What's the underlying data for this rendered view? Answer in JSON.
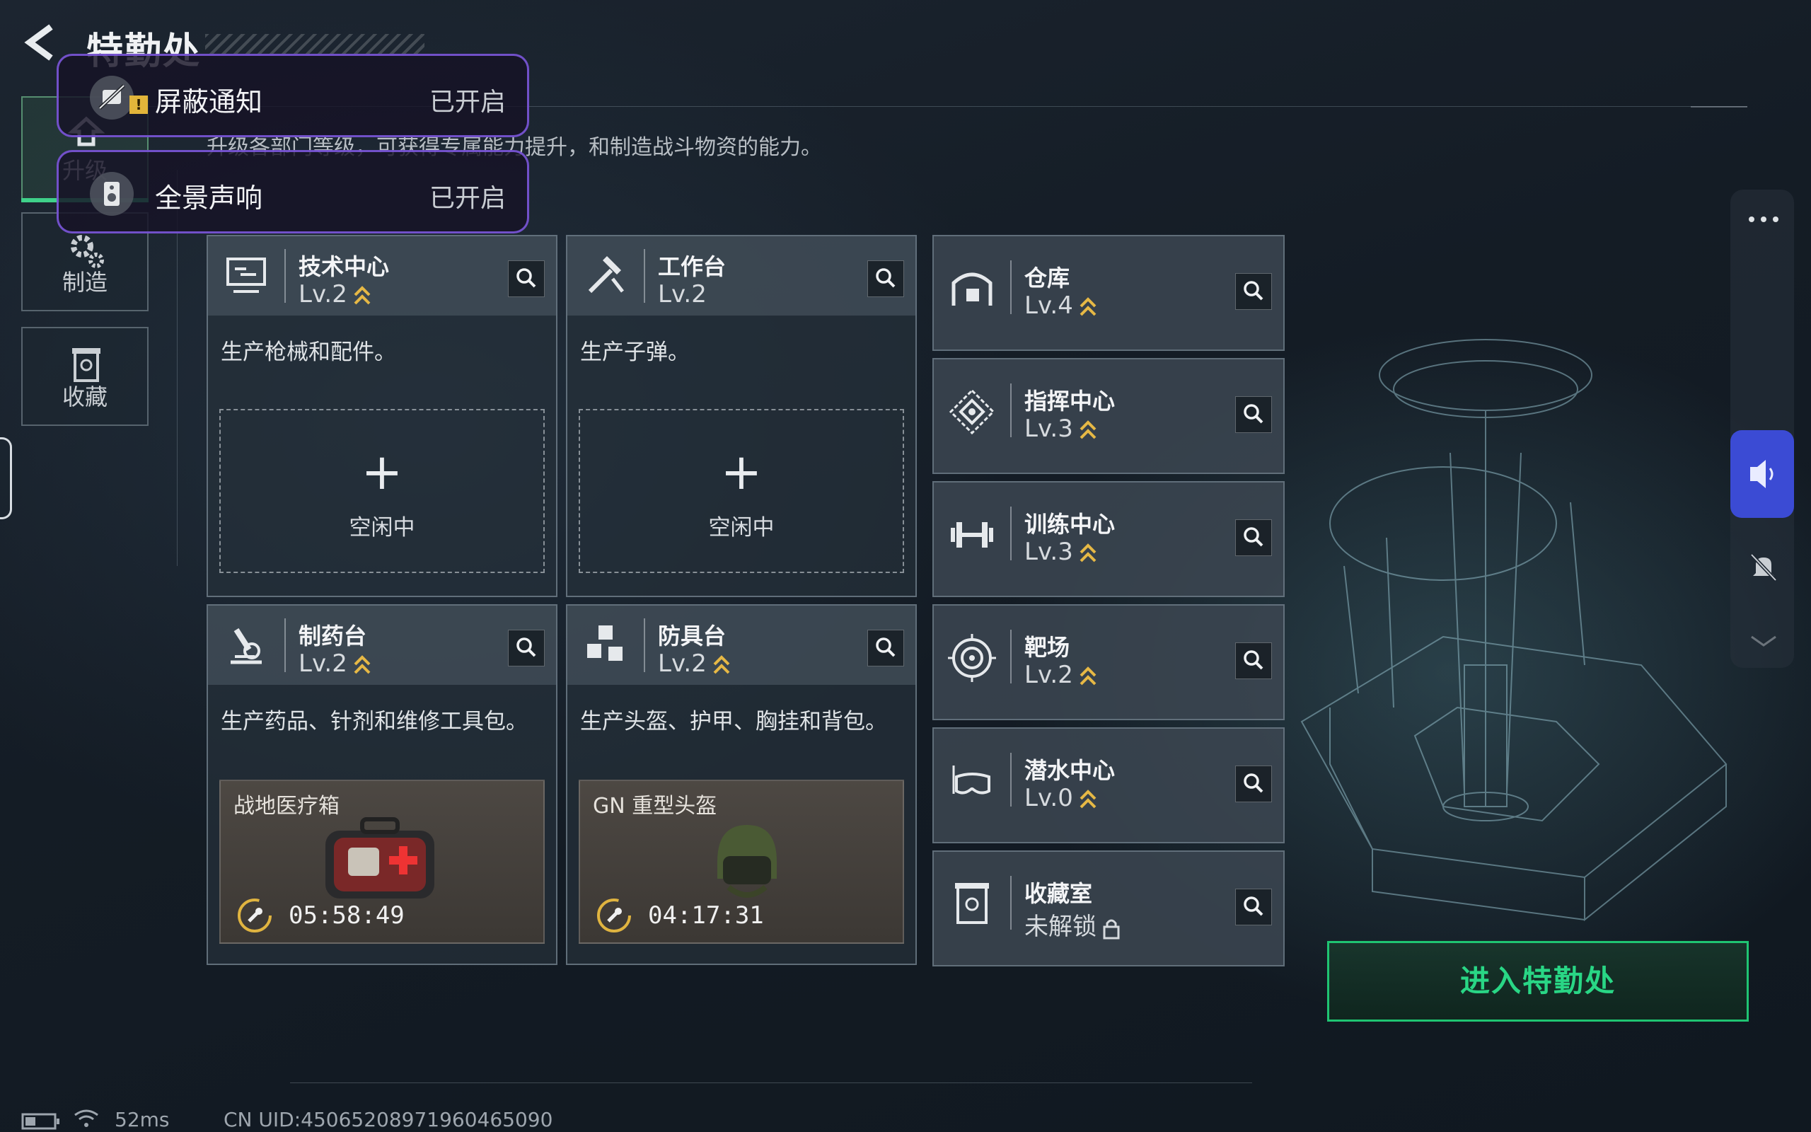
{
  "header": {
    "title": "特勤处",
    "subtitle": "升级各部门等级，可获得专属能力提升，和制造战斗物资的能力。"
  },
  "nav": {
    "items": [
      {
        "label": "升级",
        "icon": "upgrade-icon"
      },
      {
        "label": "制造",
        "icon": "gear-icon"
      },
      {
        "label": "收藏",
        "icon": "collection-icon"
      }
    ]
  },
  "notifications": [
    {
      "label": "屏蔽通知",
      "status": "已开启",
      "icon": "block-notification-icon"
    },
    {
      "label": "全景声响",
      "status": "已开启",
      "icon": "panoramic-sound-icon"
    }
  ],
  "departments_left": [
    {
      "name": "技术中心",
      "level": "Lv.2",
      "desc": "生产枪械和配件。",
      "slot": {
        "type": "empty",
        "label": "空闲中"
      },
      "icon": "tech-center-icon"
    },
    {
      "name": "工作台",
      "level": "Lv.2",
      "desc": "生产子弹。",
      "slot": {
        "type": "empty",
        "label": "空闲中"
      },
      "icon": "hammer-icon"
    },
    {
      "name": "制药台",
      "level": "Lv.2",
      "desc": "生产药品、针剂和维修工具包。",
      "slot": {
        "type": "job",
        "item": "战地医疗箱",
        "timer": "05:58:49"
      },
      "icon": "microscope-icon"
    },
    {
      "name": "防具台",
      "level": "Lv.2",
      "desc": "生产头盔、护甲、胸挂和背包。",
      "slot": {
        "type": "job",
        "item": "GN 重型头盔",
        "timer": "04:17:31"
      },
      "icon": "armor-icon"
    }
  ],
  "departments_right": [
    {
      "name": "仓库",
      "level": "Lv.4",
      "icon": "warehouse-icon"
    },
    {
      "name": "指挥中心",
      "level": "Lv.3",
      "icon": "command-icon"
    },
    {
      "name": "训练中心",
      "level": "Lv.3",
      "icon": "dumbbell-icon"
    },
    {
      "name": "靶场",
      "level": "Lv.2",
      "icon": "target-icon"
    },
    {
      "name": "潜水中心",
      "level": "Lv.0",
      "icon": "diving-mask-icon"
    },
    {
      "name": "收藏室",
      "level": "未解锁",
      "icon": "collection-room-icon",
      "locked": true
    }
  ],
  "enter_button": "进入特勤处",
  "status": {
    "ping": "52ms",
    "uid": "CN UID:450652089719604650​90"
  },
  "colors": {
    "accent_green": "#29d685",
    "notify_border": "#825ae6",
    "sound_button": "#3b4bd4",
    "level_chevron": "#e6b845"
  }
}
